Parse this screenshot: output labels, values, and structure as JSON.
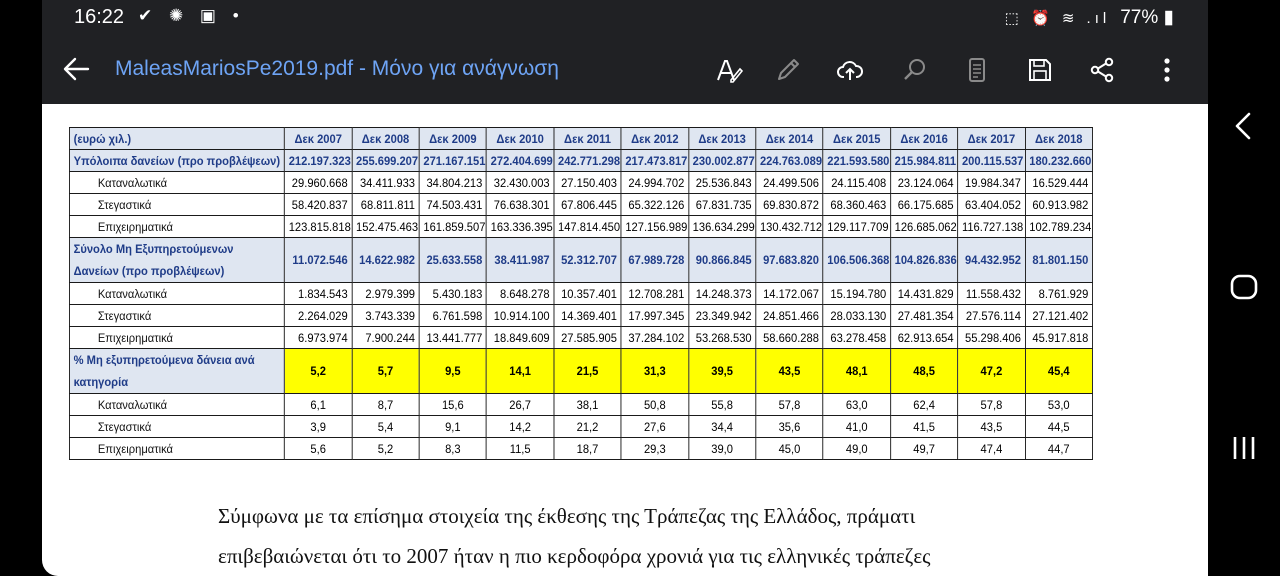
{
  "status_bar": {
    "time": "16:22",
    "left_icons": "✔ ✺ ▣ •",
    "right_icons": "⬚ ⏰ ≋ .ıl",
    "battery": "77%"
  },
  "app_bar": {
    "title": "MaleasMariosPe2019.pdf - Μόνο για ανάγνωση",
    "icons": [
      "back-arrow-icon",
      "text-annotate-icon",
      "pen-icon",
      "cloud-upload-icon",
      "search-icon",
      "document-view-icon",
      "save-icon",
      "share-icon",
      "more-vert-icon"
    ]
  },
  "table": {
    "corner": "(ευρώ χιλ.)",
    "years": [
      "Δεκ 2007",
      "Δεκ 2008",
      "Δεκ 2009",
      "Δεκ 2010",
      "Δεκ 2011",
      "Δεκ 2012",
      "Δεκ 2013",
      "Δεκ 2014",
      "Δεκ 2015",
      "Δεκ 2016",
      "Δεκ 2017",
      "Δεκ 2018"
    ],
    "rows": [
      {
        "kind": "main",
        "label": "Υπόλοιπα δανείων (προ προβλέψεων)",
        "values": [
          "212.197.323",
          "255.699.207",
          "271.167.151",
          "272.404.699",
          "242.771.298",
          "217.473.817",
          "230.002.877",
          "224.763.089",
          "221.593.580",
          "215.984.811",
          "200.115.537",
          "180.232.660"
        ]
      },
      {
        "kind": "sub",
        "label": "Καταναλωτικά",
        "values": [
          "29.960.668",
          "34.411.933",
          "34.804.213",
          "32.430.003",
          "27.150.403",
          "24.994.702",
          "25.536.843",
          "24.499.506",
          "24.115.408",
          "23.124.064",
          "19.984.347",
          "16.529.444"
        ]
      },
      {
        "kind": "sub",
        "label": "Στεγαστικά",
        "values": [
          "58.420.837",
          "68.811.811",
          "74.503.431",
          "76.638.301",
          "67.806.445",
          "65.322.126",
          "67.831.735",
          "69.830.872",
          "68.360.463",
          "66.175.685",
          "63.404.052",
          "60.913.982"
        ]
      },
      {
        "kind": "sub",
        "label": "Επιχειρηματικά",
        "values": [
          "123.815.818",
          "152.475.463",
          "161.859.507",
          "163.336.395",
          "147.814.450",
          "127.156.989",
          "136.634.299",
          "130.432.712",
          "129.117.709",
          "126.685.062",
          "116.727.138",
          "102.789.234"
        ]
      },
      {
        "kind": "main-tall",
        "label": "Σύνολο Μη Εξυπηρετούμενων Δανείων (προ προβλέψεων)",
        "values": [
          "11.072.546",
          "14.622.982",
          "25.633.558",
          "38.411.987",
          "52.312.707",
          "67.989.728",
          "90.866.845",
          "97.683.820",
          "106.506.368",
          "104.826.836",
          "94.432.952",
          "81.801.150"
        ]
      },
      {
        "kind": "sub",
        "label": "Καταναλωτικά",
        "values": [
          "1.834.543",
          "2.979.399",
          "5.430.183",
          "8.648.278",
          "10.357.401",
          "12.708.281",
          "14.248.373",
          "14.172.067",
          "15.194.780",
          "14.431.829",
          "11.558.432",
          "8.761.929"
        ]
      },
      {
        "kind": "sub",
        "label": "Στεγαστικά",
        "values": [
          "2.264.029",
          "3.743.339",
          "6.761.598",
          "10.914.100",
          "14.369.401",
          "17.997.345",
          "23.349.942",
          "24.851.466",
          "28.033.130",
          "27.481.354",
          "27.576.114",
          "27.121.402"
        ]
      },
      {
        "kind": "sub",
        "label": "Επιχειρηματικά",
        "values": [
          "6.973.974",
          "7.900.244",
          "13.441.777",
          "18.849.609",
          "27.585.905",
          "37.284.102",
          "53.268.530",
          "58.660.288",
          "63.278.458",
          "62.913.654",
          "55.298.406",
          "45.917.818"
        ]
      },
      {
        "kind": "pct",
        "label": "% Μη εξυπηρετούμενα δάνεια ανά κατηγορία",
        "values": [
          "5,2",
          "5,7",
          "9,5",
          "14,1",
          "21,5",
          "31,3",
          "39,5",
          "43,5",
          "48,1",
          "48,5",
          "47,2",
          "45,4"
        ]
      },
      {
        "kind": "pctsub",
        "label": "Καταναλωτικά",
        "values": [
          "6,1",
          "8,7",
          "15,6",
          "26,7",
          "38,1",
          "50,8",
          "55,8",
          "57,8",
          "63,0",
          "62,4",
          "57,8",
          "53,0"
        ]
      },
      {
        "kind": "pctsub",
        "label": "Στεγαστικά",
        "values": [
          "3,9",
          "5,4",
          "9,1",
          "14,2",
          "21,2",
          "27,6",
          "34,4",
          "35,6",
          "41,0",
          "41,5",
          "43,5",
          "44,5"
        ]
      },
      {
        "kind": "pctsub",
        "label": "Επιχειρηματικά",
        "values": [
          "5,6",
          "5,2",
          "8,3",
          "11,5",
          "18,7",
          "29,3",
          "39,0",
          "45,0",
          "49,0",
          "49,7",
          "47,4",
          "44,7"
        ]
      }
    ]
  },
  "paragraph": [
    "Σύμφωνα με τα επίσημα στοιχεία της έκθεσης της Τράπεζας της Ελλάδος, πράματι",
    "επιβεβαιώνεται ότι το 2007 ήταν η πιο κερδοφόρα χρονιά για τις ελληνικές τράπεζες"
  ],
  "nav": [
    "nav-back-icon",
    "nav-home-icon",
    "nav-recents-icon"
  ]
}
